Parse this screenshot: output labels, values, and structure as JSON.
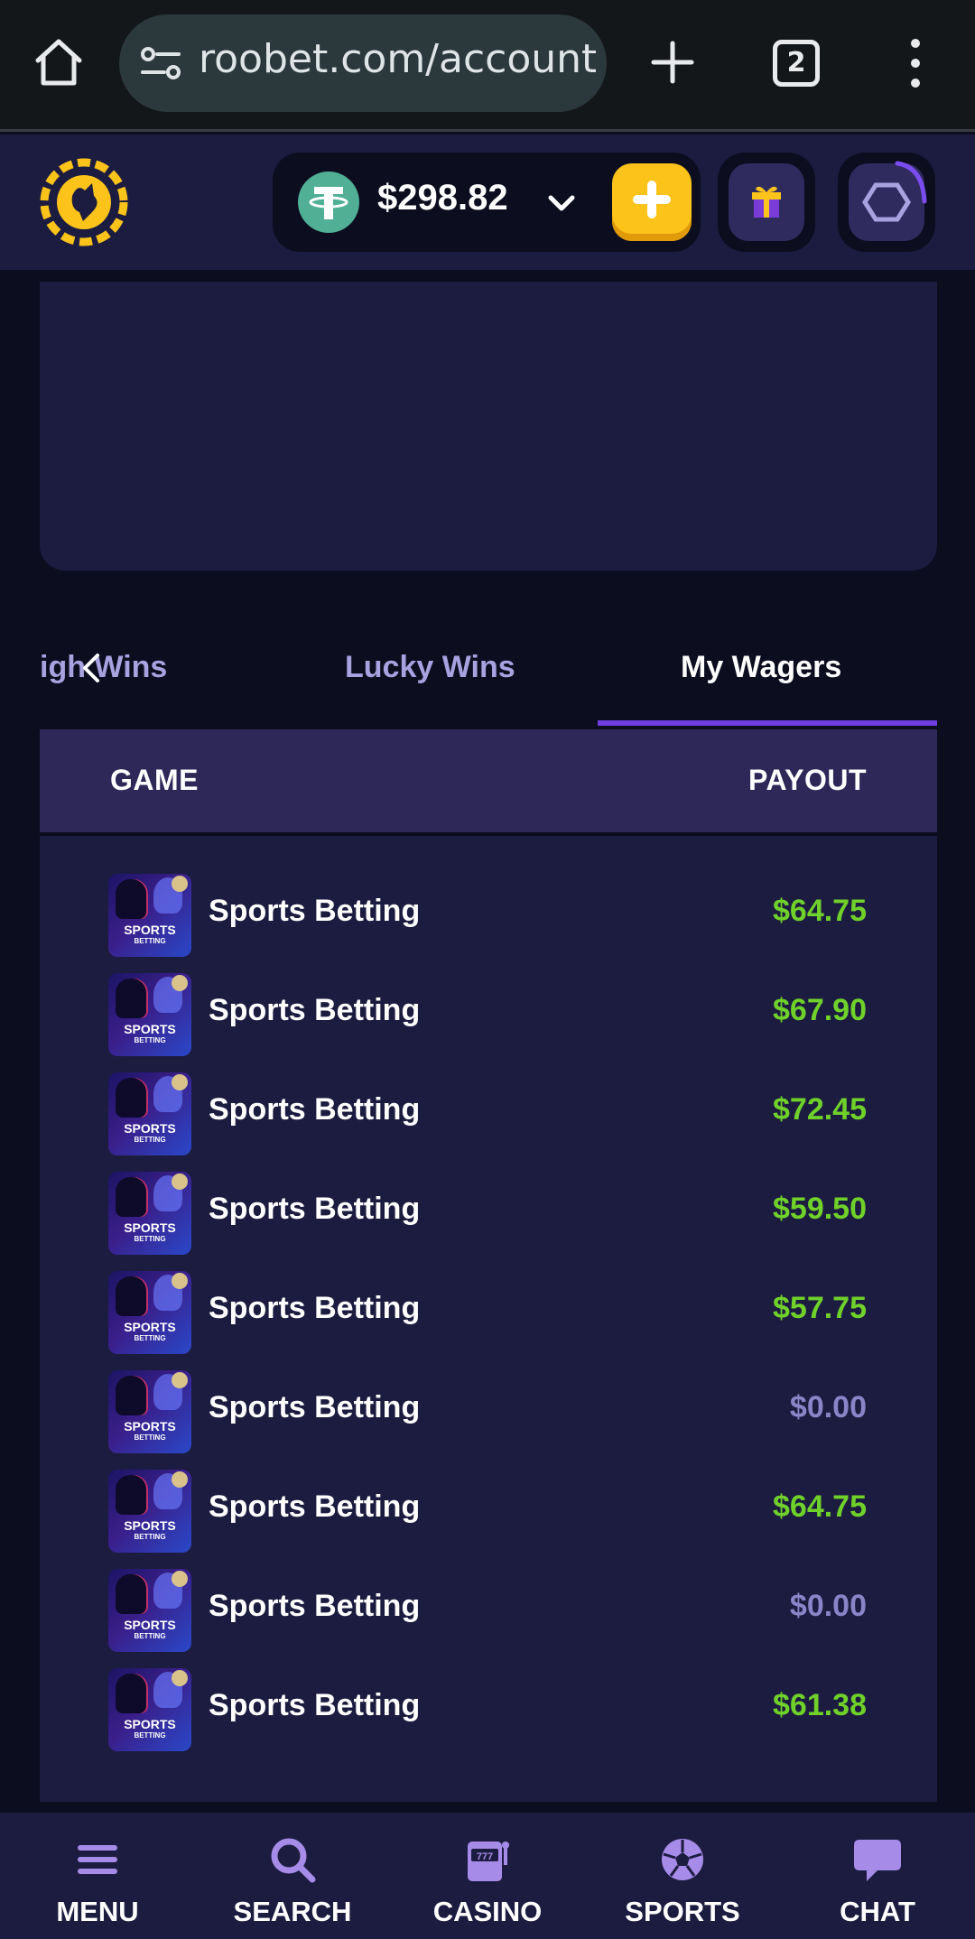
{
  "browser": {
    "url": "roobet.com/account-s",
    "tab_count": "2"
  },
  "header": {
    "balance": "$298.82",
    "colors": {
      "accent": "#fcc31b",
      "brand_bg": "#1c1c40",
      "tether": "#50af95"
    }
  },
  "tabs": [
    {
      "label": "High Wins",
      "visible_label": "igh Wins",
      "active": false
    },
    {
      "label": "Lucky Wins",
      "active": false
    },
    {
      "label": "My Wagers",
      "active": true
    }
  ],
  "table": {
    "columns": [
      "GAME",
      "PAYOUT"
    ],
    "thumb_title": "SPORTS",
    "thumb_subtitle": "BETTING",
    "rows": [
      {
        "game": "Sports Betting",
        "payout": "$64.75",
        "status": "win"
      },
      {
        "game": "Sports Betting",
        "payout": "$67.90",
        "status": "win"
      },
      {
        "game": "Sports Betting",
        "payout": "$72.45",
        "status": "win"
      },
      {
        "game": "Sports Betting",
        "payout": "$59.50",
        "status": "win"
      },
      {
        "game": "Sports Betting",
        "payout": "$57.75",
        "status": "win"
      },
      {
        "game": "Sports Betting",
        "payout": "$0.00",
        "status": "loss"
      },
      {
        "game": "Sports Betting",
        "payout": "$64.75",
        "status": "win"
      },
      {
        "game": "Sports Betting",
        "payout": "$0.00",
        "status": "loss"
      },
      {
        "game": "Sports Betting",
        "payout": "$61.38",
        "status": "win"
      }
    ],
    "colors": {
      "win": "#6fd12a",
      "loss": "#8a84c8"
    }
  },
  "bottom_nav": [
    {
      "label": "MENU",
      "icon": "menu-icon"
    },
    {
      "label": "SEARCH",
      "icon": "search-icon"
    },
    {
      "label": "CASINO",
      "icon": "slot-machine-icon"
    },
    {
      "label": "SPORTS",
      "icon": "soccer-ball-icon"
    },
    {
      "label": "CHAT",
      "icon": "chat-bubble-icon"
    }
  ]
}
